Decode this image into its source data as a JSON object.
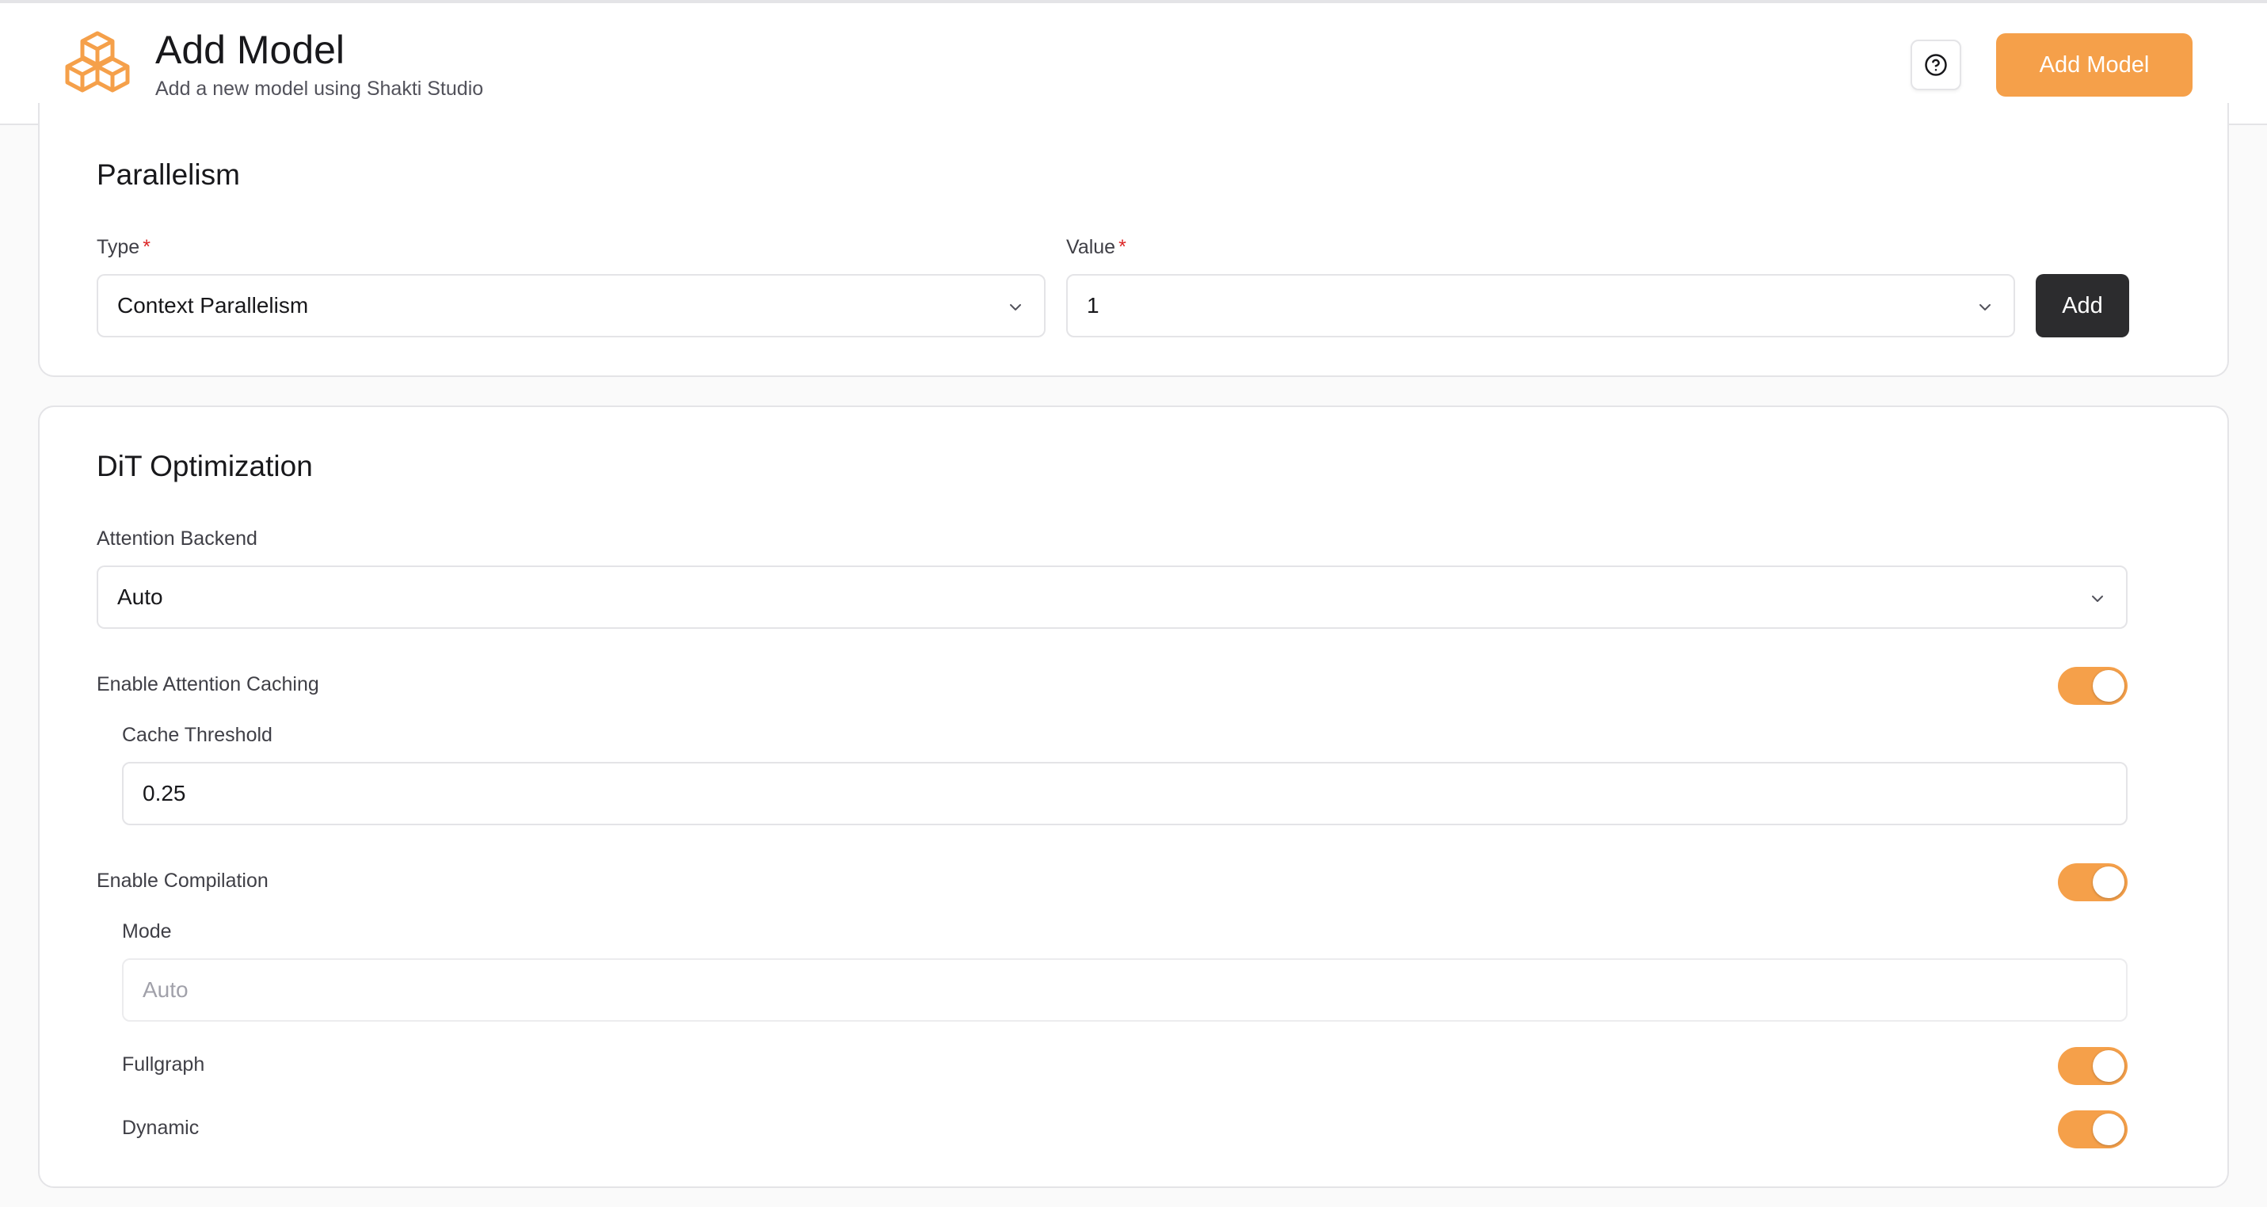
{
  "header": {
    "title": "Add Model",
    "subtitle": "Add a new model using Shakti Studio",
    "help_icon": "help-circle-icon",
    "primary_button": "Add Model",
    "accent_color": "#f5a04a"
  },
  "parallelism": {
    "title": "Parallelism",
    "type_label": "Type",
    "type_value": "Context Parallelism",
    "value_label": "Value",
    "value_value": "1",
    "required_mark": "*",
    "add_button": "Add"
  },
  "dit": {
    "title": "DiT Optimization",
    "attention_backend_label": "Attention Backend",
    "attention_backend_value": "Auto",
    "attention_caching_label": "Enable Attention Caching",
    "attention_caching_on": true,
    "cache_threshold_label": "Cache Threshold",
    "cache_threshold_value": "0.25",
    "compilation_label": "Enable Compilation",
    "compilation_on": true,
    "mode_label": "Mode",
    "mode_placeholder": "Auto",
    "fullgraph_label": "Fullgraph",
    "fullgraph_on": true,
    "dynamic_label": "Dynamic",
    "dynamic_on": true
  }
}
